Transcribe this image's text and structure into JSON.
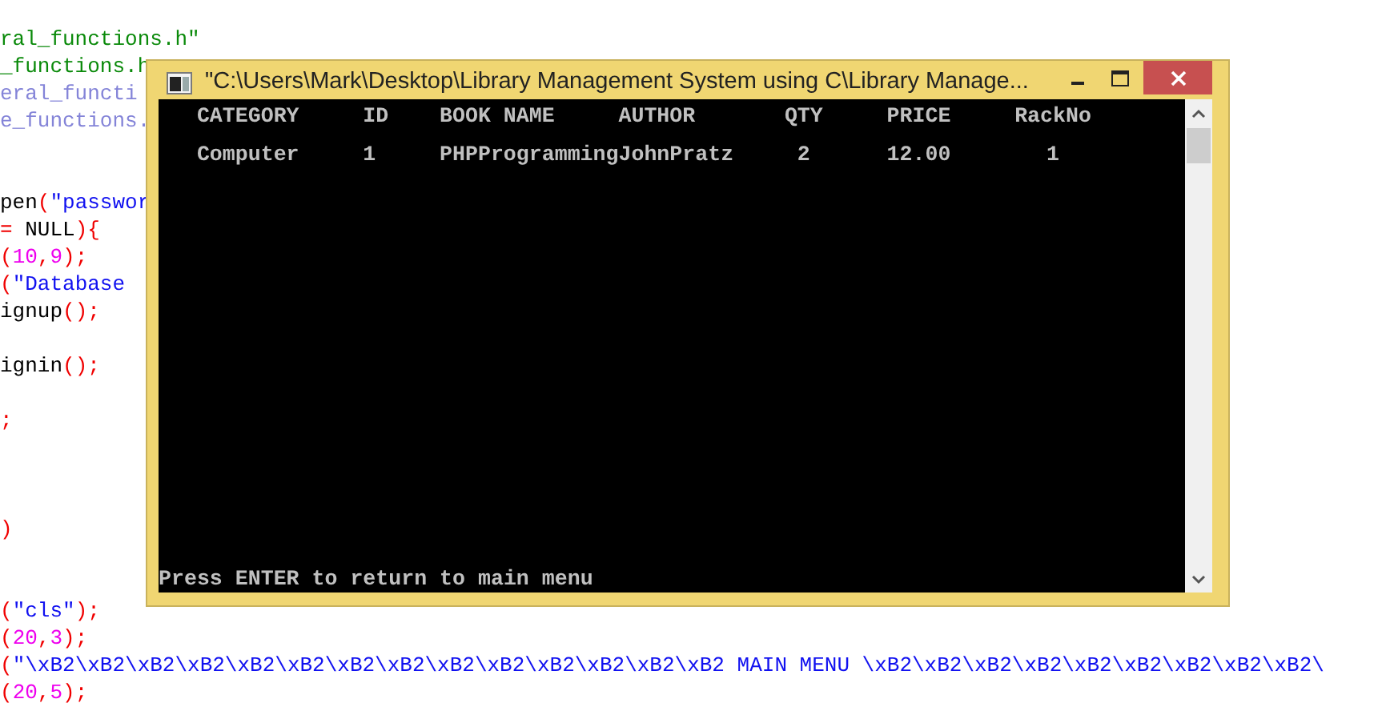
{
  "editor": {
    "lines": [
      {
        "kind": "code",
        "segments": [
          {
            "kind": "header",
            "text": "ral_functions.h\""
          }
        ]
      },
      {
        "kind": "code",
        "segments": [
          {
            "kind": "header",
            "text": "_functions.h"
          }
        ]
      },
      {
        "kind": "code",
        "segments": [
          {
            "kind": "dim",
            "text": "eral_functi"
          }
        ]
      },
      {
        "kind": "code",
        "segments": [
          {
            "kind": "dim",
            "text": "e_functions."
          }
        ]
      },
      {
        "kind": "blank"
      },
      {
        "kind": "blank"
      },
      {
        "kind": "code",
        "segments": [
          {
            "kind": "plain",
            "text": "pen"
          },
          {
            "kind": "operator",
            "text": "("
          },
          {
            "kind": "string",
            "text": "\"passwor"
          }
        ]
      },
      {
        "kind": "code",
        "segments": [
          {
            "kind": "operator",
            "text": "="
          },
          {
            "kind": "plain",
            "text": " NULL"
          },
          {
            "kind": "operator",
            "text": "){"
          }
        ]
      },
      {
        "kind": "code",
        "segments": [
          {
            "kind": "operator",
            "text": "("
          },
          {
            "kind": "number",
            "text": "10"
          },
          {
            "kind": "operator",
            "text": ","
          },
          {
            "kind": "number",
            "text": "9"
          },
          {
            "kind": "operator",
            "text": ");"
          }
        ]
      },
      {
        "kind": "code",
        "segments": [
          {
            "kind": "operator",
            "text": "("
          },
          {
            "kind": "string",
            "text": "\"Database"
          }
        ]
      },
      {
        "kind": "code",
        "segments": [
          {
            "kind": "plain",
            "text": "ignup"
          },
          {
            "kind": "operator",
            "text": "();"
          }
        ]
      },
      {
        "kind": "blank"
      },
      {
        "kind": "code",
        "segments": [
          {
            "kind": "plain",
            "text": "ignin"
          },
          {
            "kind": "operator",
            "text": "();"
          }
        ]
      },
      {
        "kind": "blank"
      },
      {
        "kind": "code",
        "segments": [
          {
            "kind": "operator",
            "text": ";"
          }
        ]
      },
      {
        "kind": "blank"
      },
      {
        "kind": "blank"
      },
      {
        "kind": "blank"
      },
      {
        "kind": "code",
        "segments": [
          {
            "kind": "operator",
            "text": ")"
          }
        ]
      },
      {
        "kind": "blank"
      },
      {
        "kind": "blank"
      },
      {
        "kind": "code",
        "segments": [
          {
            "kind": "operator",
            "text": "("
          },
          {
            "kind": "string",
            "text": "\"cls\""
          },
          {
            "kind": "operator",
            "text": ");"
          }
        ]
      },
      {
        "kind": "code",
        "segments": [
          {
            "kind": "operator",
            "text": "("
          },
          {
            "kind": "number",
            "text": "20"
          },
          {
            "kind": "operator",
            "text": ","
          },
          {
            "kind": "number",
            "text": "3"
          },
          {
            "kind": "operator",
            "text": ");"
          }
        ]
      },
      {
        "kind": "code",
        "segments": [
          {
            "kind": "operator",
            "text": "("
          },
          {
            "kind": "string",
            "text": "\"\\xB2\\xB2\\xB2\\xB2\\xB2\\xB2\\xB2\\xB2\\xB2\\xB2\\xB2\\xB2\\xB2\\xB2 MAIN MENU \\xB2\\xB2\\xB2\\xB2\\xB2\\xB2\\xB2\\xB2\\xB2\\"
          }
        ]
      },
      {
        "kind": "code",
        "segments": [
          {
            "kind": "operator",
            "text": "("
          },
          {
            "kind": "number",
            "text": "20"
          },
          {
            "kind": "operator",
            "text": ","
          },
          {
            "kind": "number",
            "text": "5"
          },
          {
            "kind": "operator",
            "text": ");"
          }
        ]
      }
    ]
  },
  "console_window": {
    "title": "\"C:\\Users\\Mark\\Desktop\\Library Management System using C\\Library Manage...",
    "columns": [
      "CATEGORY",
      "ID",
      "BOOK NAME",
      "AUTHOR",
      "QTY",
      "PRICE",
      "RackNo"
    ],
    "rows": [
      [
        "Computer",
        "1",
        "PHPProgramming",
        "JohnPratz",
        "2",
        "12.00",
        "1"
      ]
    ],
    "prompt": "Press ENTER to return to main menu"
  }
}
